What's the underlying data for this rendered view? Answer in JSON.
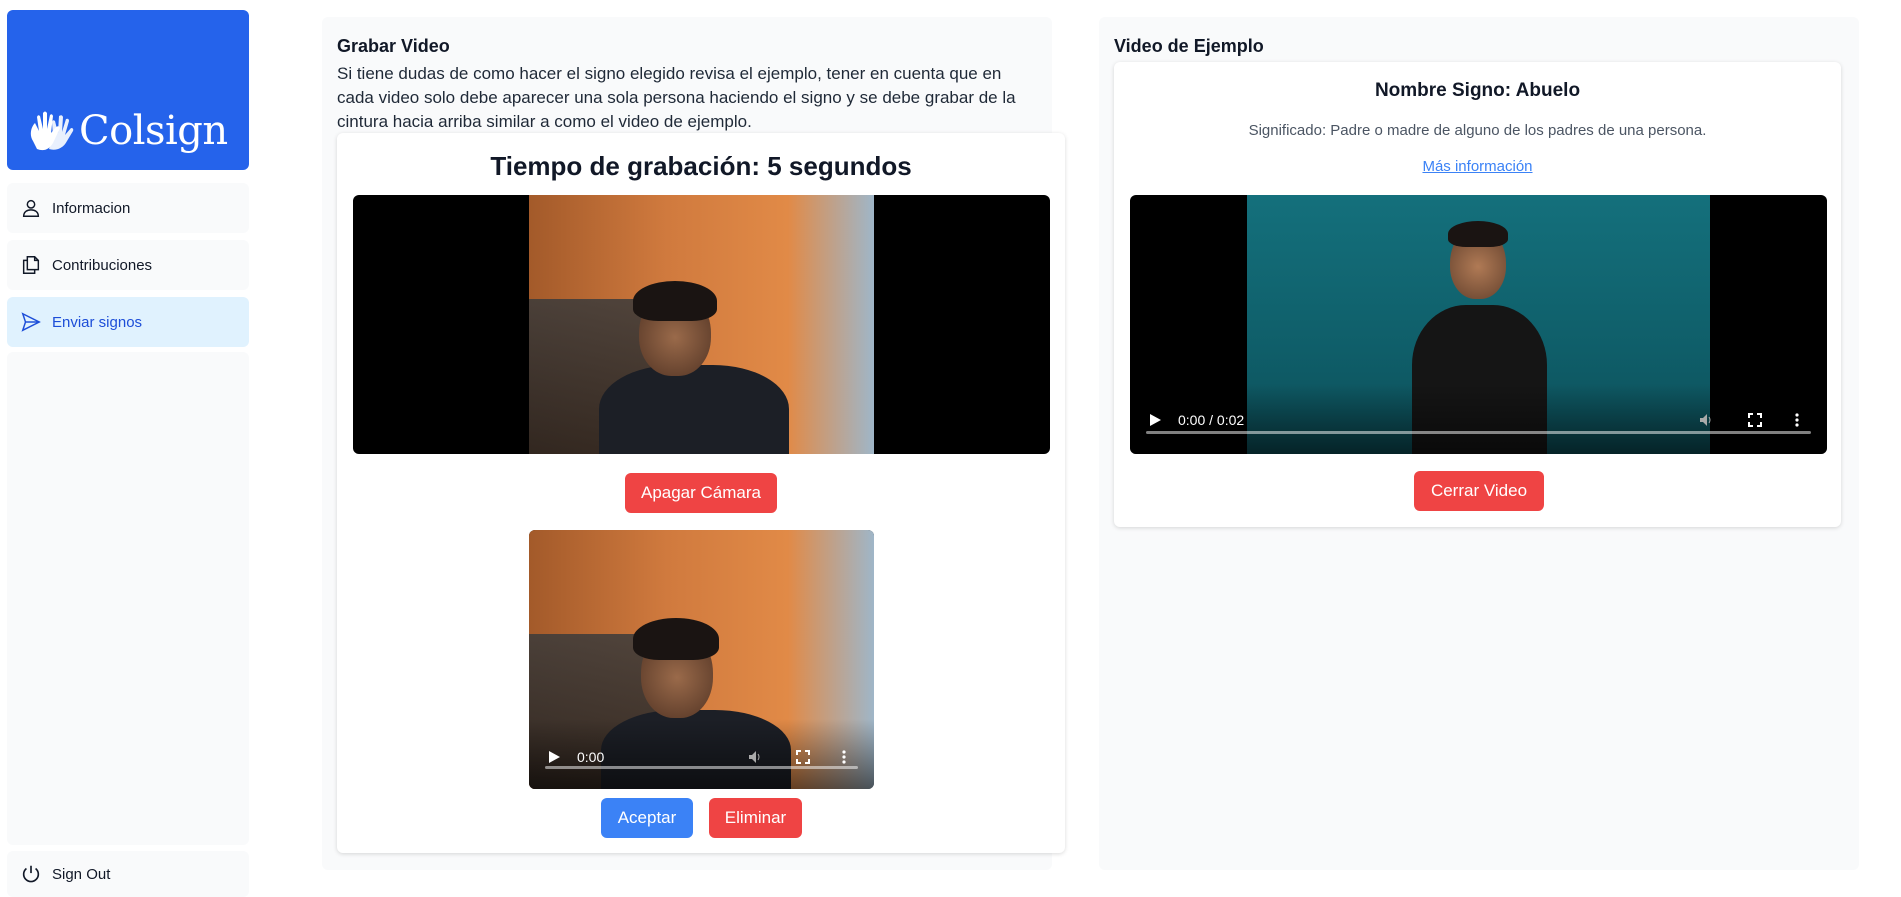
{
  "brand": {
    "name": "Colsign",
    "color": "#2563eb"
  },
  "sidebar": {
    "items": [
      {
        "label": "Informacion",
        "icon": "user-icon",
        "active": false
      },
      {
        "label": "Contribuciones",
        "icon": "documents-icon",
        "active": false
      },
      {
        "label": "Enviar signos",
        "icon": "send-icon",
        "active": true
      }
    ],
    "signout": {
      "label": "Sign Out",
      "icon": "power-icon"
    }
  },
  "record": {
    "title": "Grabar Video",
    "description": "Si tiene dudas de como hacer el signo elegido revisa el ejemplo, tener en cuenta que en cada video solo debe aparecer una sola persona haciendo el signo y se debe grabar de la cintura hacia arriba similar a como el video de ejemplo.",
    "timer_label": "Tiempo de grabación: 5 segundos",
    "camera_button": "Apagar Cámara",
    "playback_time": "0:00",
    "accept_button": "Aceptar",
    "delete_button": "Eliminar"
  },
  "example": {
    "title": "Video de Ejemplo",
    "sign_name": "Nombre Signo: Abuelo",
    "meaning": "Significado: Padre o madre de alguno de los padres de una persona.",
    "more_info": "Más información",
    "time": "0:00 / 0:02",
    "close_button": "Cerrar Video"
  },
  "colors": {
    "danger": "#ef4444",
    "primary": "#3b82f6",
    "active_nav_bg": "#e0f2fe"
  }
}
